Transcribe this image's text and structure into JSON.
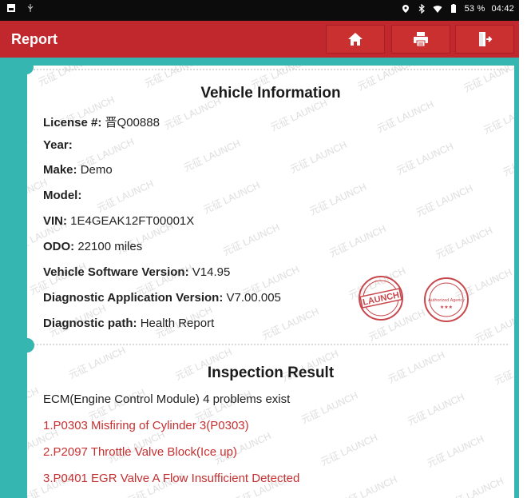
{
  "status": {
    "battery": "53 %",
    "time": "04:42"
  },
  "header": {
    "title": "Report",
    "colors": {
      "bar": "#c0282d",
      "teal": "#35b6b0",
      "error": "#c63031"
    }
  },
  "vehicle": {
    "heading": "Vehicle Information",
    "fields": [
      {
        "label": "License #:",
        "value": "晋Q00888"
      },
      {
        "label": "Year:",
        "value": ""
      },
      {
        "label": "Make:",
        "value": "Demo"
      },
      {
        "label": "Model:",
        "value": ""
      },
      {
        "label": "VIN:",
        "value": "1E4GEAK12FT00001X"
      },
      {
        "label": "ODO:",
        "value": "22100 miles"
      },
      {
        "label": "Vehicle Software Version:",
        "value": "V14.95"
      },
      {
        "label": "Diagnostic Application Version:",
        "value": "V7.00.005"
      },
      {
        "label": "Diagnostic path:",
        "value": "Health Report"
      }
    ]
  },
  "stamps": {
    "launch": "LAUNCH",
    "authorized": "Authorized Agency"
  },
  "inspection": {
    "heading": "Inspection Result",
    "summary": "ECM(Engine Control Module) 4 problems exist",
    "problems": [
      "1.P0303 Misfiring of Cylinder 3(P0303)",
      "2.P2097 Throttle Valve Block(Ice up)",
      "3.P0401 EGR Valve A Flow Insufficient Detected"
    ]
  }
}
